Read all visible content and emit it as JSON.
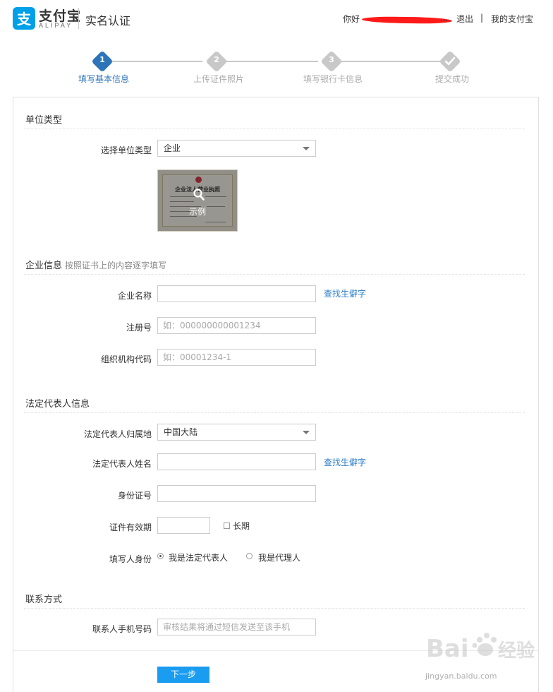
{
  "header": {
    "brand_cn": "支付宝",
    "brand_en": "ALIPAY",
    "title": "实名认证",
    "greeting": "你好",
    "user_ellipsis": "...",
    "logout": "退出",
    "separator": "|",
    "my_alipay": "我的支付宝"
  },
  "steps": [
    {
      "num": "1",
      "label": "填写基本信息",
      "state": "active"
    },
    {
      "num": "2",
      "label": "上传证件照片",
      "state": "pending"
    },
    {
      "num": "3",
      "label": "填写银行卡信息",
      "state": "pending"
    },
    {
      "num": "",
      "label": "提交成功",
      "state": "pending"
    }
  ],
  "unit_type": {
    "title": "单位类型",
    "select_label": "选择单位类型",
    "selected": "企业",
    "sample_cert_title": "企业法人营业执照",
    "sample_label": "示例"
  },
  "company": {
    "title": "企业信息",
    "hint": "按照证书上的内容逐字填写",
    "name_label": "企业名称",
    "name_value": "",
    "rare_char_link": "查找生僻字",
    "reg_label": "注册号",
    "reg_placeholder": "如：000000000001234",
    "org_label": "组织机构代码",
    "org_placeholder": "如：00001234-1"
  },
  "legal": {
    "title": "法定代表人信息",
    "region_label": "法定代表人归属地",
    "region_selected": "中国大陆",
    "name_label": "法定代表人姓名",
    "name_value": "",
    "rare_char_link": "查找生僻字",
    "id_label": "身份证号",
    "id_value": "",
    "validity_label": "证件有效期",
    "validity_value": "",
    "long_term_label": "长期",
    "long_term_checked": false,
    "filler_label": "填写人身份",
    "filler_options": [
      "我是法定代表人",
      "我是代理人"
    ],
    "filler_selected": 0
  },
  "contact": {
    "title": "联系方式",
    "phone_label": "联系人手机号码",
    "phone_placeholder": "审核结果将通过短信发送至该手机"
  },
  "actions": {
    "next_label": "下一步"
  },
  "watermark": {
    "text": "jingyan.baidu.com"
  },
  "colors": {
    "accent": "#1a9cf0",
    "step_active": "#2d74b8",
    "step_pending": "#c8c8c8",
    "link": "#2d7dc8",
    "logo": "#00a0e9",
    "redaction": "#ff1a1a"
  }
}
